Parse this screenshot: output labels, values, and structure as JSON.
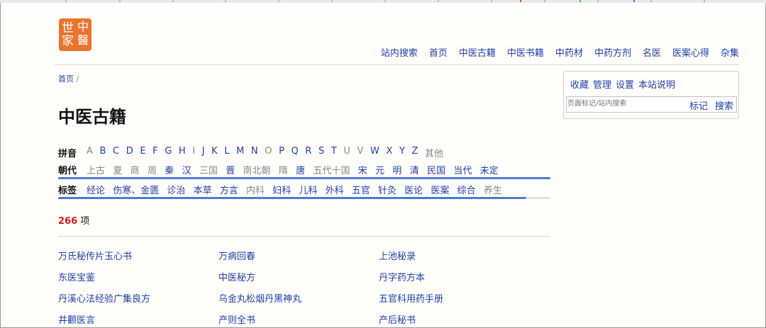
{
  "logo": {
    "chars": [
      "中",
      "世",
      "醫",
      "家"
    ]
  },
  "nav": [
    "站内搜索",
    "首页",
    "中医古籍",
    "中医书籍",
    "中药材",
    "中药方剂",
    "名医",
    "医案心得",
    "杂集"
  ],
  "breadcrumb": {
    "home": "首页",
    "sep": "/"
  },
  "page_title": "中医古籍",
  "pinyin": {
    "label": "拼音",
    "items": [
      {
        "t": "A",
        "on": false
      },
      {
        "t": "B",
        "on": true
      },
      {
        "t": "C",
        "on": true
      },
      {
        "t": "D",
        "on": true
      },
      {
        "t": "E",
        "on": true
      },
      {
        "t": "F",
        "on": true
      },
      {
        "t": "G",
        "on": true
      },
      {
        "t": "H",
        "on": true
      },
      {
        "t": "I",
        "on": false
      },
      {
        "t": "J",
        "on": true
      },
      {
        "t": "K",
        "on": true
      },
      {
        "t": "L",
        "on": true
      },
      {
        "t": "M",
        "on": true
      },
      {
        "t": "N",
        "on": true
      },
      {
        "t": "O",
        "on": false
      },
      {
        "t": "P",
        "on": true
      },
      {
        "t": "Q",
        "on": true
      },
      {
        "t": "R",
        "on": true
      },
      {
        "t": "S",
        "on": true
      },
      {
        "t": "T",
        "on": true
      },
      {
        "t": "U",
        "on": false
      },
      {
        "t": "V",
        "on": false
      },
      {
        "t": "W",
        "on": true
      },
      {
        "t": "X",
        "on": true
      },
      {
        "t": "Y",
        "on": true
      },
      {
        "t": "Z",
        "on": true
      },
      {
        "t": "其他",
        "on": false
      }
    ]
  },
  "dynasty": {
    "label": "朝代",
    "items": [
      {
        "t": "上古",
        "on": false
      },
      {
        "t": "夏",
        "on": false
      },
      {
        "t": "商",
        "on": false
      },
      {
        "t": "周",
        "on": false
      },
      {
        "t": "秦",
        "on": true
      },
      {
        "t": "汉",
        "on": true
      },
      {
        "t": "三国",
        "on": false
      },
      {
        "t": "晋",
        "on": true
      },
      {
        "t": "南北朝",
        "on": false
      },
      {
        "t": "隋",
        "on": false
      },
      {
        "t": "唐",
        "on": true
      },
      {
        "t": "五代十国",
        "on": false
      },
      {
        "t": "宋",
        "on": true
      },
      {
        "t": "元",
        "on": true
      },
      {
        "t": "明",
        "on": true
      },
      {
        "t": "清",
        "on": true
      },
      {
        "t": "民国",
        "on": true
      },
      {
        "t": "当代",
        "on": true
      },
      {
        "t": "未定",
        "on": true
      }
    ]
  },
  "tags": {
    "label": "标签",
    "items": [
      {
        "t": "经论",
        "on": true
      },
      {
        "t": "伤寒、金匮",
        "on": true
      },
      {
        "t": "诊治",
        "on": true
      },
      {
        "t": "本草",
        "on": true
      },
      {
        "t": "方言",
        "on": true
      },
      {
        "t": "内科",
        "on": false
      },
      {
        "t": "妇科",
        "on": true
      },
      {
        "t": "儿科",
        "on": true
      },
      {
        "t": "外科",
        "on": true
      },
      {
        "t": "五官",
        "on": true
      },
      {
        "t": "针灸",
        "on": true
      },
      {
        "t": "医论",
        "on": true
      },
      {
        "t": "医案",
        "on": true
      },
      {
        "t": "综合",
        "on": true
      },
      {
        "t": "养生",
        "on": false
      }
    ]
  },
  "count": {
    "number": "266",
    "unit": "项"
  },
  "books": [
    [
      "万氏秘传片玉心书",
      "万病回春",
      "上池秘录"
    ],
    [
      "东医宝鉴",
      "中医秘方",
      "丹字药方本"
    ],
    [
      "丹溪心法经验广集良方",
      "乌金丸松烟丹黑神丸",
      "五官科用药手册"
    ],
    [
      "井颧医言",
      "产则全书",
      "产后秘书"
    ]
  ],
  "sidebar": {
    "links": [
      "收藏",
      "管理",
      "设置",
      "本站说明"
    ],
    "search_placeholder": "页面标记/站内搜索",
    "mark_label": "标记",
    "search_label": "搜索"
  },
  "colors": {
    "link": "#1f3ea6",
    "count": "#d21b1b",
    "bar": "#4a7bd8",
    "logo": "#e8742e"
  }
}
